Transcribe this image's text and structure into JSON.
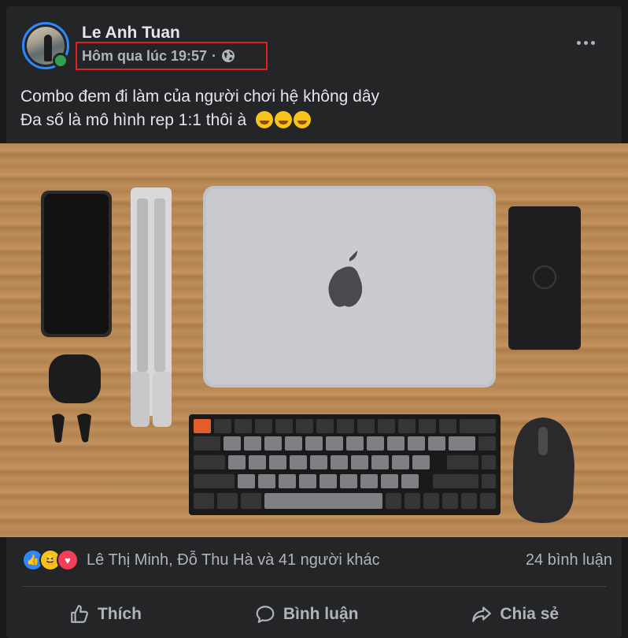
{
  "post": {
    "author": "Le Anh Tuan",
    "timestamp": "Hôm qua lúc 19:57",
    "separator": "·",
    "privacy_icon": "globe-icon",
    "text_line1": "Combo đem đi làm của người chơi hệ không dây",
    "text_line2": "Đa số là mô hình rep 1:1 thôi à",
    "emojis": [
      "hugging-face-emoji",
      "hugging-face-emoji",
      "hugging-face-emoji"
    ]
  },
  "reactions": {
    "icons": [
      "like-icon",
      "haha-icon",
      "love-icon"
    ],
    "names": "Lê Thị Minh, Đỗ Thu Hà và 41 người khác",
    "comments": "24 bình luận"
  },
  "actions": {
    "like": "Thích",
    "comment": "Bình luận",
    "share": "Chia sẻ"
  },
  "colors": {
    "background": "#18191a",
    "card": "#242526",
    "text_primary": "#e4e6eb",
    "text_secondary": "#b0b3b8",
    "highlight_box": "#e41e1e",
    "online": "#31a24c"
  }
}
